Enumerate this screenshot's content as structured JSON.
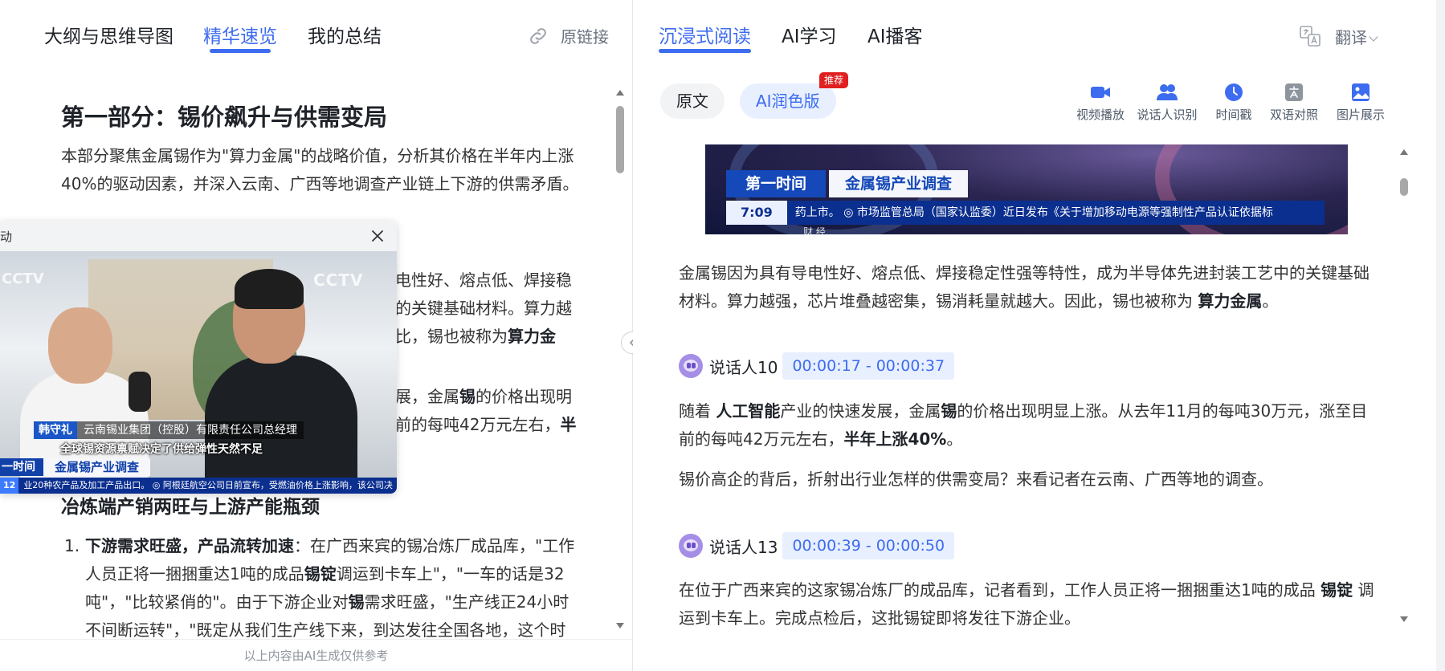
{
  "left_tabs": [
    {
      "label": "大纲与思维导图"
    },
    {
      "label": "精华速览"
    },
    {
      "label": "我的总结"
    }
  ],
  "original_link_label": "原链接",
  "section": {
    "title": "第一部分：锡价飙升与供需变局",
    "intro": "本部分聚焦金属锡作为\"算力金属\"的战略价值，分析其价格在半年内上涨40%的驱动因素，并深入云南、广西等地调查产业链上下游的供需矛盾。",
    "para2_a": "电性好、熔点低、焊接稳",
    "para2_b": "的关键基础材料。算力越",
    "para2_c": "比，锡也被称为",
    "para2_bold": "算力金",
    "para3_a": "展，金属",
    "para3_bold1": "锡",
    "para3_b": "的价格出现明",
    "para3_c": "前的每吨42万元左右，",
    "para3_bold2": "半",
    "subtitle": "冶炼端产销两旺与上游产能瓶颈",
    "list_num": "1.",
    "list_bold": "下游需求旺盛，产品流转加速",
    "list_a": "：在广西来宾的锡冶炼厂成品库，\"工作人员正将一捆捆重达1吨的成品",
    "list_bold2": "锡锭",
    "list_b": "调运到卡车上\"，\"一车的话是32吨\"，\"比较紧俏的\"。由于下游企业对",
    "list_bold3": "锡",
    "list_c": "需求旺盛，\"生产线正24小时不间断运转\"，\"既定从我们生产线下来，到达发往全国各地，这个时"
  },
  "footer_note": "以上内容由AI生成仅供参考",
  "float_video": {
    "title": "动",
    "logo_left": "CCTV",
    "logo_right": "CCTV",
    "person_name": "韩守礼",
    "person_role": "云南锡业集团（控股）有限责任公司总经理",
    "caption": "全球锡资源禀赋决定了供给弹性天然不足",
    "banner_left": "一时间",
    "banner_right": "金属锡产业调查",
    "ticker_num": "12",
    "ticker_text": "业20种农产品及加工产品出口。   ◎ 阿根廷航空公司日前宣布，受燃油价格上涨影响，该公司决"
  },
  "right_tabs": [
    {
      "label": "沉浸式阅读"
    },
    {
      "label": "AI学习"
    },
    {
      "label": "AI播客"
    }
  ],
  "translate_label": "翻译",
  "mode_pills": {
    "original": "原文",
    "ai_polished": "AI润色版",
    "badge": "推荐"
  },
  "toolbar": [
    {
      "label": "视频播放",
      "icon": "video-camera-icon"
    },
    {
      "label": "说话人识别",
      "icon": "speakers-icon"
    },
    {
      "label": "时间戳",
      "icon": "clock-icon"
    },
    {
      "label": "双语对照",
      "icon": "translate-icon"
    },
    {
      "label": "图片展示",
      "icon": "image-icon"
    }
  ],
  "banner": {
    "left": "第一时间",
    "right": "金属锡产业调查",
    "time": "7:09",
    "ticker": "药上市。      ◎ 市场监管总局（国家认监委）近日发布《关于增加移动电源等强制性产品认证依据标",
    "bottom": "财 经"
  },
  "transcript": {
    "p1_a": "金属锡因为具有导电性好、熔点低、焊接稳定性强等特性，成为半导体先进封装工艺中的关键基础材料。算力越强，芯片堆叠越密集，锡消耗量就越大。因此，锡也被称为 ",
    "p1_bold": "算力金属",
    "p1_end": "。",
    "speaker1": {
      "name": "说话人10",
      "time": "00:00:17 - 00:00:37"
    },
    "p2_a": "随着 ",
    "p2_bold1": "人工智能",
    "p2_b": "产业的快速发展，金属",
    "p2_bold2": "锡",
    "p2_c": "的价格出现明显上涨。从去年11月的每吨30万元，涨至目前的每吨42万元左右，",
    "p2_bold3": "半年上涨40%",
    "p2_end": "。",
    "p3": "锡价高企的背后，折射出行业怎样的供需变局？来看记者在云南、广西等地的调查。",
    "speaker2": {
      "name": "说话人13",
      "time": "00:00:39 - 00:00:50"
    },
    "p4_a": "在位于广西来宾的这家锡冶炼厂的成品库，记者看到，工作人员正将一捆捆重达1吨的成品 ",
    "p4_bold": "锡锭",
    "p4_b": " 调运到卡车上。完成点检后，这批锡锭即将发往下游企业。"
  },
  "colors": {
    "accent": "#3d6cf0",
    "badge_red": "#e02020",
    "avatar_purple": "#a58ee6"
  }
}
